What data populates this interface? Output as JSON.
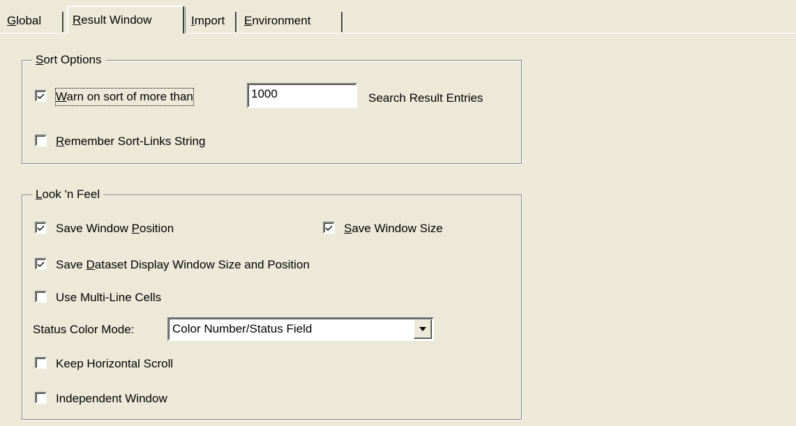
{
  "tabs": [
    {
      "pre": "",
      "accel": "G",
      "post": "lobal",
      "active": false
    },
    {
      "pre": "",
      "accel": "R",
      "post": "esult Window",
      "active": true
    },
    {
      "pre": "",
      "accel": "I",
      "post": "mport",
      "active": false
    },
    {
      "pre": "",
      "accel": "E",
      "post": "nvironment",
      "active": false
    }
  ],
  "sort_options": {
    "title_accel": "S",
    "title_rest": "ort Options",
    "warn_checkbox": {
      "checked": true,
      "accel": "W",
      "rest": "arn on sort of more than"
    },
    "warn_threshold": "1000",
    "warn_suffix": "Search Result Entries",
    "remember_checkbox": {
      "checked": false,
      "accel": "R",
      "rest": "emember Sort-Links String"
    }
  },
  "look_n_feel": {
    "title_accel": "L",
    "title_rest": "ook 'n Feel",
    "save_window_position": {
      "checked": true,
      "pre": "Save Window ",
      "accel": "P",
      "post": "osition"
    },
    "save_window_size": {
      "checked": true,
      "pre": "",
      "accel": "S",
      "post": "ave Window Size"
    },
    "save_dataset_display": {
      "checked": true,
      "pre": "Save ",
      "accel": "D",
      "post": "ataset Display Window Size and Position"
    },
    "use_multiline_cells": {
      "checked": false,
      "label": "Use Multi-Line Cells"
    },
    "status_color_mode_label": "Status Color Mode:",
    "status_color_mode_value": "Color Number/Status Field",
    "keep_horizontal_scroll": {
      "checked": false,
      "label": "Keep Horizontal Scroll"
    },
    "independent_window": {
      "checked": false,
      "label": "Independent Window"
    }
  },
  "colors": {
    "dialog_background": "#ece9d8",
    "shadow": "#808080",
    "highlight": "#ffffff"
  },
  "icons": {
    "checkmark": "checkmark-icon",
    "dropdown": "dropdown-arrow-icon"
  }
}
